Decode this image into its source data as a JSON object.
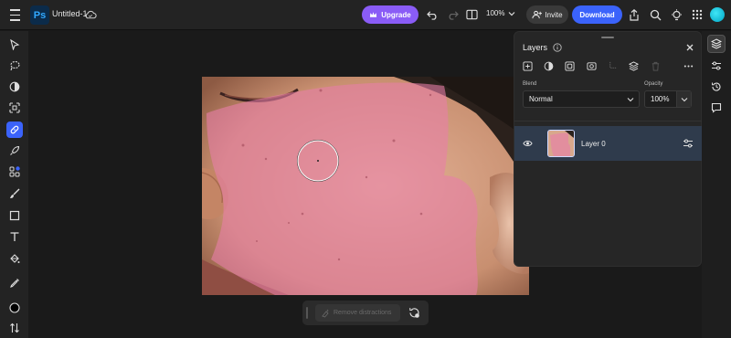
{
  "app": {
    "logo_text": "Ps",
    "doc_title": "Untitled-1"
  },
  "topbar": {
    "upgrade_label": "Upgrade",
    "zoom_label": "100%",
    "invite_label": "Invite",
    "download_label": "Download"
  },
  "colors": {
    "accent": "#3b63fb",
    "upgrade": "#8a5cf6",
    "selected_layer": "#2f3b4c",
    "mask_overlay": "#e87fa8"
  },
  "left_tools": [
    {
      "name": "select-tool-icon"
    },
    {
      "name": "lasso-tool-icon"
    },
    {
      "name": "adjustment-tool-icon"
    },
    {
      "name": "crop-tool-icon"
    },
    {
      "name": "heal-tool-icon",
      "active": true
    },
    {
      "name": "rocket-tool-icon"
    },
    {
      "name": "shapes-tool-icon"
    },
    {
      "name": "brush-tool-icon"
    },
    {
      "name": "rectangle-tool-icon"
    },
    {
      "name": "text-tool-icon"
    },
    {
      "name": "fill-tool-icon"
    },
    {
      "name": "eyedropper-tool-icon"
    },
    {
      "name": "color-swatch-icon"
    },
    {
      "name": "swap-icon"
    }
  ],
  "layers_panel": {
    "title": "Layers",
    "blend_label": "Blend",
    "blend_value": "Normal",
    "opacity_label": "Opacity",
    "opacity_value": "100%",
    "layers": [
      {
        "name": "Layer 0",
        "visible": true,
        "selected": true
      }
    ]
  },
  "context_bar": {
    "remove_label": "Remove distractions"
  }
}
